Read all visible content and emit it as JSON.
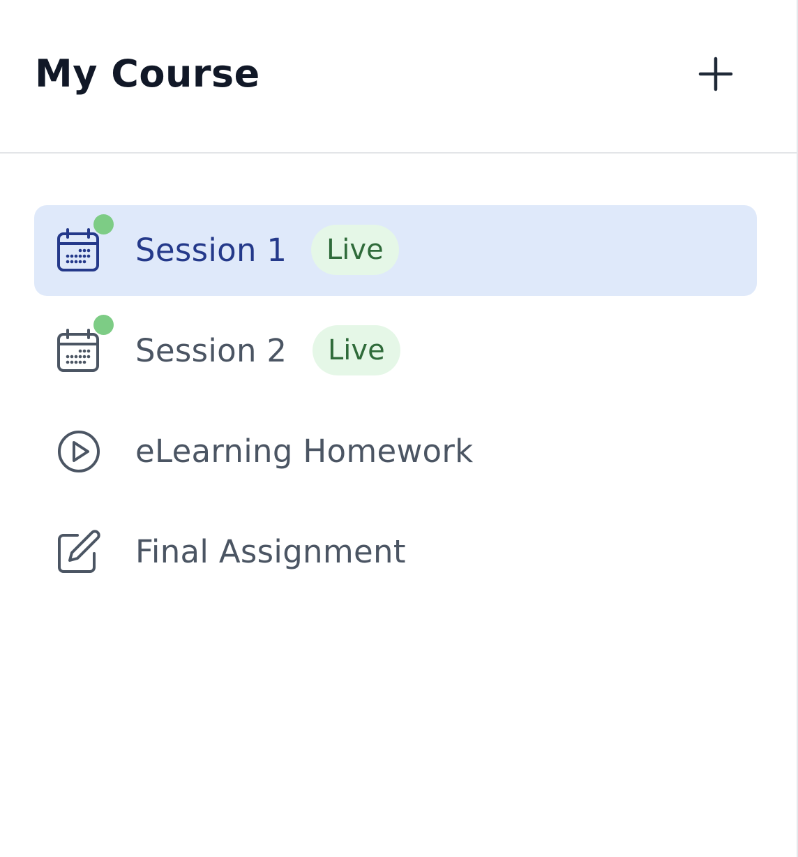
{
  "header": {
    "title": "My Course",
    "add_icon": "plus-icon"
  },
  "items": [
    {
      "label": "Session 1",
      "badge": "Live",
      "icon": "calendar-icon",
      "status_dot": true,
      "active": true
    },
    {
      "label": "Session 2",
      "badge": "Live",
      "icon": "calendar-icon",
      "status_dot": true,
      "active": false
    },
    {
      "label": "eLearning Homework",
      "icon": "play-circle-icon",
      "active": false
    },
    {
      "label": "Final Assignment",
      "icon": "edit-icon",
      "active": false
    }
  ],
  "colors": {
    "active_bg": "#dfe9fa",
    "active_text": "#24398a",
    "badge_bg": "#e5f7e7",
    "badge_text": "#2f6b3a",
    "status_dot": "#7dcc85"
  }
}
